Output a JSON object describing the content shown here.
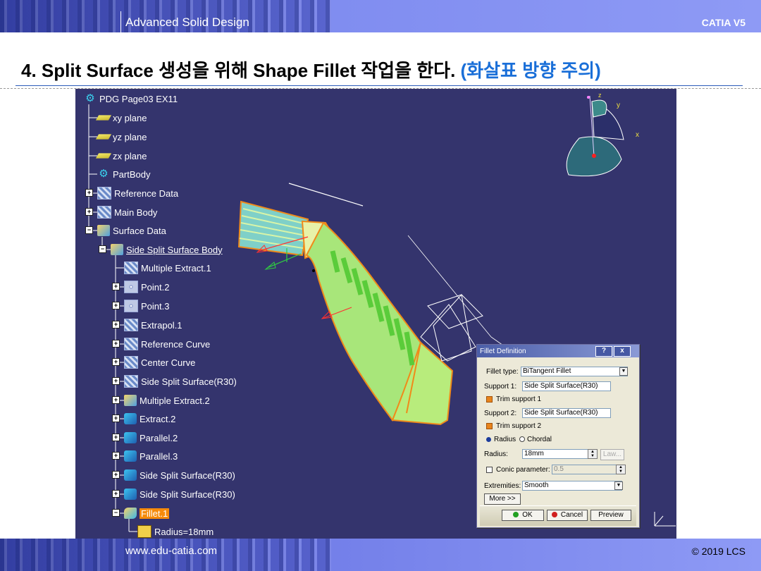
{
  "header": {
    "course_title": "Advanced Solid Design",
    "product": "CATIA V5"
  },
  "heading": {
    "text": "4. Split Surface 생성을 위해 Shape Fillet 작업을 한다.",
    "note": "(화살표 방향 주의)"
  },
  "tree": {
    "items": [
      {
        "label": "PDG Page03 EX11",
        "icon": "part-icon"
      },
      {
        "label": "xy plane",
        "icon": "plane-icon"
      },
      {
        "label": "yz plane",
        "icon": "plane-icon"
      },
      {
        "label": "zx plane",
        "icon": "plane-icon"
      },
      {
        "label": "PartBody",
        "icon": "gear-icon"
      },
      {
        "label": "Reference Data",
        "icon": "geometrical-set-icon"
      },
      {
        "label": "Main Body",
        "icon": "geometrical-set-icon"
      },
      {
        "label": "Surface Data",
        "icon": "geometrical-set-icon"
      },
      {
        "label": "Side Split Surface Body",
        "icon": "body-icon"
      },
      {
        "label": "Multiple Extract.1",
        "icon": "extract-icon"
      },
      {
        "label": "Point.2",
        "icon": "point-icon"
      },
      {
        "label": "Point.3",
        "icon": "point-icon"
      },
      {
        "label": "Extrapol.1",
        "icon": "extrapol-icon"
      },
      {
        "label": "Reference Curve",
        "icon": "curve-icon"
      },
      {
        "label": "Center Curve",
        "icon": "curve-icon"
      },
      {
        "label": "Side Split Surface(R30)",
        "icon": "surface-icon"
      },
      {
        "label": "Multiple Extract.2",
        "icon": "extract-icon"
      },
      {
        "label": "Extract.2",
        "icon": "extract-icon"
      },
      {
        "label": "Parallel.2",
        "icon": "parallel-icon"
      },
      {
        "label": "Parallel.3",
        "icon": "parallel-icon"
      },
      {
        "label": "Side Split Surface(R30)",
        "icon": "surface-icon"
      },
      {
        "label": "Side Split Surface(R30)",
        "icon": "surface-icon"
      },
      {
        "label": "Fillet.1",
        "icon": "fillet-icon"
      },
      {
        "label": "Radius=18mm",
        "icon": "parameter-icon"
      }
    ]
  },
  "compass": {
    "x_label": "x",
    "y_label": "y",
    "z_label": "z"
  },
  "dialog": {
    "title": "Fillet Definition",
    "help": "?",
    "close": "x",
    "fillet_type_label": "Fillet type:",
    "fillet_type_value": "BiTangent Fillet",
    "support1_label": "Support 1:",
    "support1_value": "Side Split Surface(R30)",
    "trim1_label": "Trim support 1",
    "support2_label": "Support 2:",
    "support2_value": "Side Split Surface(R30)",
    "trim2_label": "Trim support 2",
    "radius_option": "Radius",
    "chordal_option": "Chordal",
    "radius_label": "Radius:",
    "radius_value": "18mm",
    "law_button": "Law...",
    "conic_label": "Conic parameter:",
    "conic_value": "0.5",
    "extremities_label": "Extremities:",
    "extremities_value": "Smooth",
    "more_button": "More >>",
    "ok_button": "OK",
    "cancel_button": "Cancel",
    "preview_button": "Preview"
  },
  "footer": {
    "url": "www.edu-catia.com",
    "copyright": "© 2019 LCS"
  }
}
